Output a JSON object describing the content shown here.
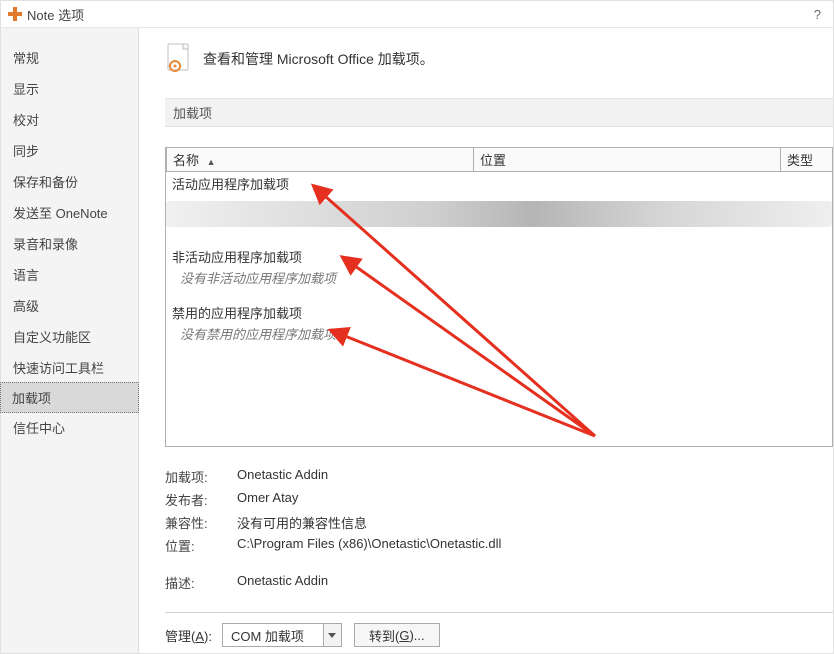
{
  "window": {
    "title": "Note 选项",
    "help_symbol": "?"
  },
  "sidebar": {
    "items": [
      {
        "id": "general",
        "label": "常规"
      },
      {
        "id": "display",
        "label": "显示"
      },
      {
        "id": "proofing",
        "label": "校对"
      },
      {
        "id": "sync",
        "label": "同步"
      },
      {
        "id": "save",
        "label": "保存和备份"
      },
      {
        "id": "sendto",
        "label": "发送至 OneNote"
      },
      {
        "id": "audio",
        "label": "录音和录像"
      },
      {
        "id": "language",
        "label": "语言"
      },
      {
        "id": "advanced",
        "label": "高级"
      },
      {
        "id": "customize",
        "label": "自定义功能区"
      },
      {
        "id": "qat",
        "label": "快速访问工具栏"
      },
      {
        "id": "addins",
        "label": "加载项",
        "selected": true
      },
      {
        "id": "trust",
        "label": "信任中心"
      }
    ]
  },
  "header": {
    "text": "查看和管理 Microsoft Office 加载项。"
  },
  "section": {
    "label": "加载项"
  },
  "table": {
    "columns": {
      "name": "名称",
      "sort_caret": "▲",
      "location": "位置",
      "type": "类型"
    },
    "groups": [
      {
        "title": "活动应用程序加载项"
      },
      {
        "title": "非活动应用程序加载项",
        "empty_msg": "没有非活动应用程序加载项"
      },
      {
        "title": "禁用的应用程序加载项",
        "empty_msg": "没有禁用的应用程序加载项"
      }
    ]
  },
  "details": {
    "rows": [
      {
        "key": "加载项:",
        "val": "Onetastic Addin"
      },
      {
        "key": "发布者:",
        "val": "Omer Atay"
      },
      {
        "key": "兼容性:",
        "val": "没有可用的兼容性信息"
      },
      {
        "key": "位置:",
        "val": "C:\\Program Files (x86)\\Onetastic\\Onetastic.dll"
      }
    ],
    "desc_key": "描述:",
    "desc_val": "Onetastic Addin"
  },
  "footer": {
    "manage_label_pre": "管理(",
    "manage_access": "A",
    "manage_label_post": "):",
    "combo_value": "COM 加载项",
    "go_pre": "转到(",
    "go_access": "G",
    "go_post": ")..."
  }
}
